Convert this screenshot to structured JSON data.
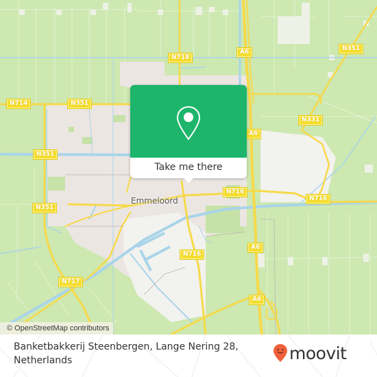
{
  "map": {
    "city_label": "Emmeloord",
    "road_labels": [
      {
        "id": "n714",
        "text": "N714"
      },
      {
        "id": "n351-top",
        "text": "N351"
      },
      {
        "id": "n718",
        "text": "N718"
      },
      {
        "id": "a6-top",
        "text": "A6"
      },
      {
        "id": "n351-right",
        "text": "N351"
      },
      {
        "id": "a6-mid",
        "text": "A6"
      },
      {
        "id": "n331",
        "text": "N331"
      },
      {
        "id": "n351-left",
        "text": "N351"
      },
      {
        "id": "n351-left2",
        "text": "N351"
      },
      {
        "id": "n716-center",
        "text": "N716"
      },
      {
        "id": "n716-right",
        "text": "N716"
      },
      {
        "id": "a6-lower",
        "text": "A6"
      },
      {
        "id": "n716-south",
        "text": "N716"
      },
      {
        "id": "n717",
        "text": "N717"
      },
      {
        "id": "a6-bottom",
        "text": "A6"
      }
    ],
    "attribution": "© OpenStreetMap contributors",
    "colors": {
      "farmland": "#cde8b0",
      "urban": "#ece6e2",
      "industrial": "#f2f2ee",
      "water": "#a9d4ea",
      "road": "#f6d94a",
      "road_label_bg": "#f5dd2c"
    }
  },
  "popup": {
    "icon": "map-pin-icon",
    "cta_label": "Take me there",
    "accent_color": "#1db56b"
  },
  "footer": {
    "address": "Banketbakkerij Steenbergen, Lange Nering 28, Netherlands",
    "brand": {
      "name": "moovit",
      "logo_icon": "moovit-pin-icon",
      "logo_color": "#f0603a"
    }
  }
}
